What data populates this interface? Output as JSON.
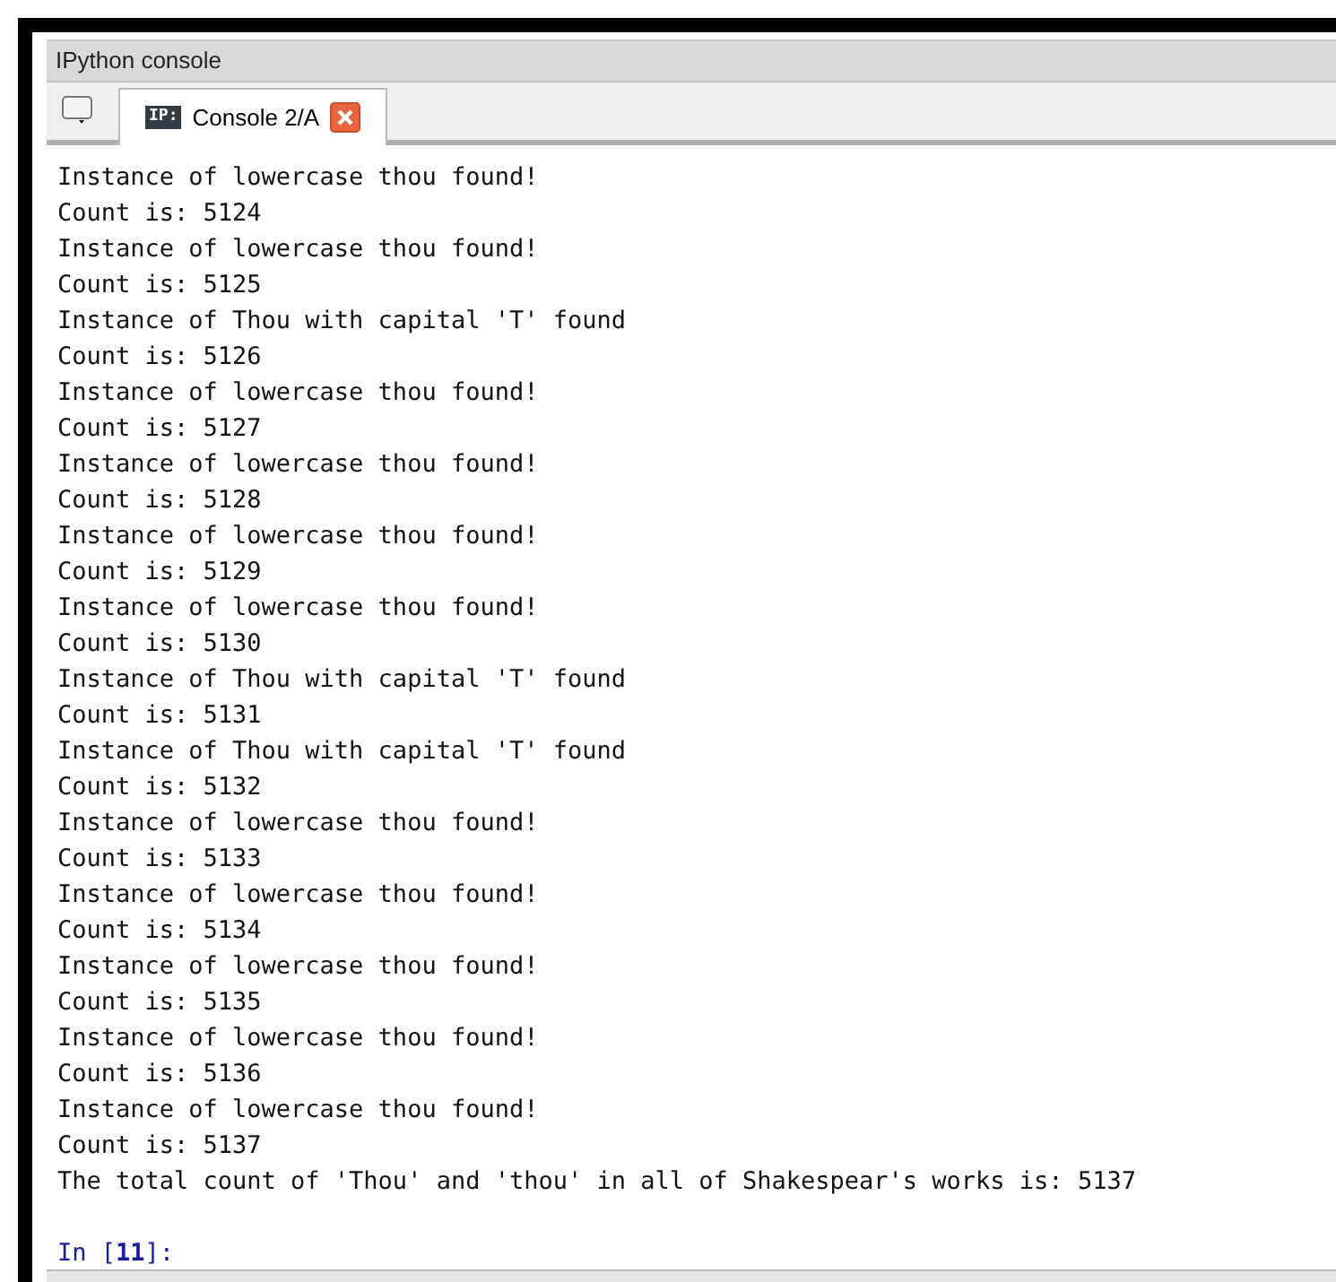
{
  "panel": {
    "title": "IPython console"
  },
  "tabs": [
    {
      "badge": "IP:",
      "label": "Console 2/A",
      "selected": true
    }
  ],
  "output": [
    "Instance of lowercase thou found!",
    "Count is: 5124",
    "Instance of lowercase thou found!",
    "Count is: 5125",
    "Instance of Thou with capital 'T' found",
    "Count is: 5126",
    "Instance of lowercase thou found!",
    "Count is: 5127",
    "Instance of lowercase thou found!",
    "Count is: 5128",
    "Instance of lowercase thou found!",
    "Count is: 5129",
    "Instance of lowercase thou found!",
    "Count is: 5130",
    "Instance of Thou with capital 'T' found",
    "Count is: 5131",
    "Instance of Thou with capital 'T' found",
    "Count is: 5132",
    "Instance of lowercase thou found!",
    "Count is: 5133",
    "Instance of lowercase thou found!",
    "Count is: 5134",
    "Instance of lowercase thou found!",
    "Count is: 5135",
    "Instance of lowercase thou found!",
    "Count is: 5136",
    "Instance of lowercase thou found!",
    "Count is: 5137",
    "The total count of 'Thou' and 'thou' in all of Shakespear's works is: 5137"
  ],
  "prompt": "In [**11**]:"
}
